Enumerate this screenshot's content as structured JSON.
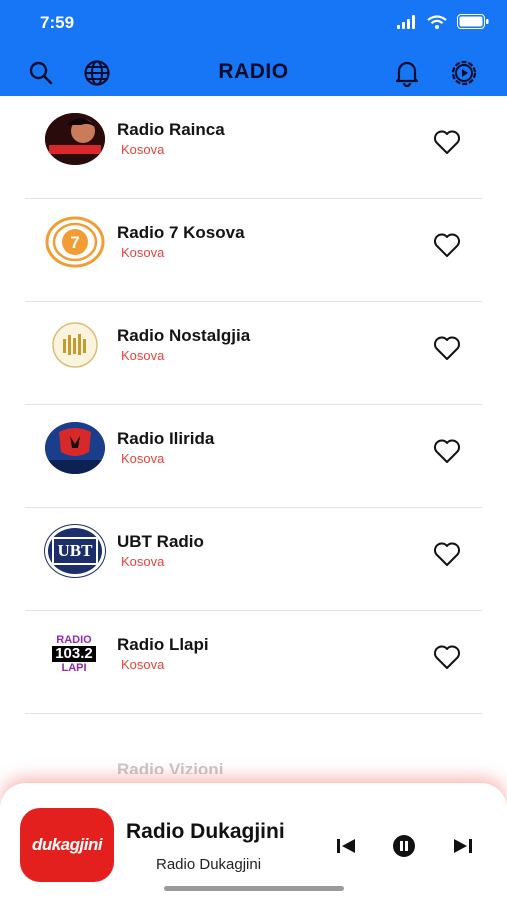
{
  "status_bar": {
    "time": "7:59"
  },
  "header": {
    "title": "RADIO"
  },
  "stations": [
    {
      "name": "Radio Rainca",
      "country": "Kosova",
      "logo_color": "#8b1a1a"
    },
    {
      "name": "Radio 7 Kosova",
      "country": "Kosova",
      "logo_color": "#f39c34"
    },
    {
      "name": "Radio Nostalgjia",
      "country": "Kosova",
      "logo_color": "#c49b2c"
    },
    {
      "name": "Radio Ilirida",
      "country": "Kosova",
      "logo_color": "#1b3e8c"
    },
    {
      "name": "UBT Radio",
      "country": "Kosova",
      "logo_color": "#1c2f6b",
      "logo_text": "UBT"
    },
    {
      "name": "Radio Llapi",
      "country": "Kosova",
      "logo_color": "#8e2bb0",
      "logo_text_top": "RADIO",
      "logo_text_mid": "103.2",
      "logo_text_bottom": "LAPI"
    }
  ],
  "partial_station": {
    "name": "Radio Vizioni"
  },
  "player": {
    "title": "Radio Dukagjini",
    "subtitle": "Radio Dukagjini",
    "art_text": "dukagjini",
    "art_color": "#e4201f"
  },
  "colors": {
    "header_bg": "#1676f6",
    "accent_red": "#e8423a"
  }
}
